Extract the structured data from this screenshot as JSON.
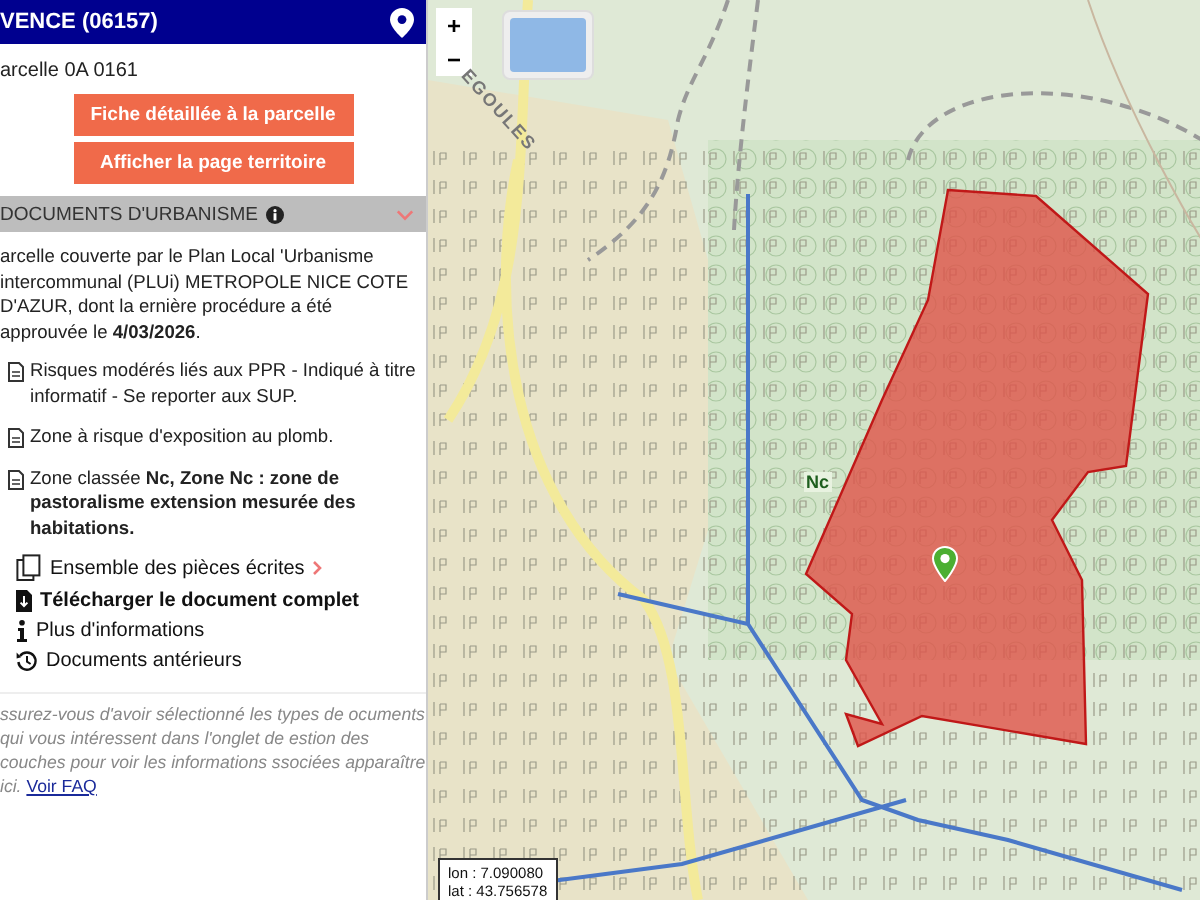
{
  "header": {
    "title": "VENCE (06157)"
  },
  "parcel": {
    "label": "arcelle 0A 0161"
  },
  "buttons": [
    "Fiche détaillée à la parcelle",
    "Afficher la page territoire"
  ],
  "section": {
    "title": "DOCUMENTS D'URBANISME",
    "expanded": true
  },
  "summary": "arcelle couverte par le Plan Local 'Urbanisme intercommunal (PLUi) METROPOLE NICE COTE D'AZUR, dont la ernière procédure a été approuvée le **4/03/2026**.",
  "notices": [
    "Risques modérés liés aux PPR - Indiqué à titre informatif - Se reporter aux SUP.",
    "Zone à risque d'exposition au plomb.",
    "Zone classée **Nc, Zone Nc : zone de pastoralisme extension mesurée des habitations.**"
  ],
  "links": [
    {
      "kind": "collection",
      "label": "Ensemble des pièces écrites"
    },
    {
      "kind": "download",
      "label": "Télécharger le document complet"
    },
    {
      "kind": "info",
      "label": "Plus d'informations"
    },
    {
      "kind": "history",
      "label": "Documents antérieurs"
    }
  ],
  "footer": {
    "text": "ssurez-vous d'avoir sélectionné les types de ocuments qui vous intéressent dans l'onglet de estion des couches pour voir les informations ssociées apparaître ici.",
    "link": "Voir FAQ"
  },
  "map": {
    "zoom": [
      "+",
      "−"
    ],
    "road_label": "EGOULES",
    "zone_label": "Nc",
    "coordinates": [
      "lon : 7.090080",
      "lat : 43.756578"
    ]
  }
}
